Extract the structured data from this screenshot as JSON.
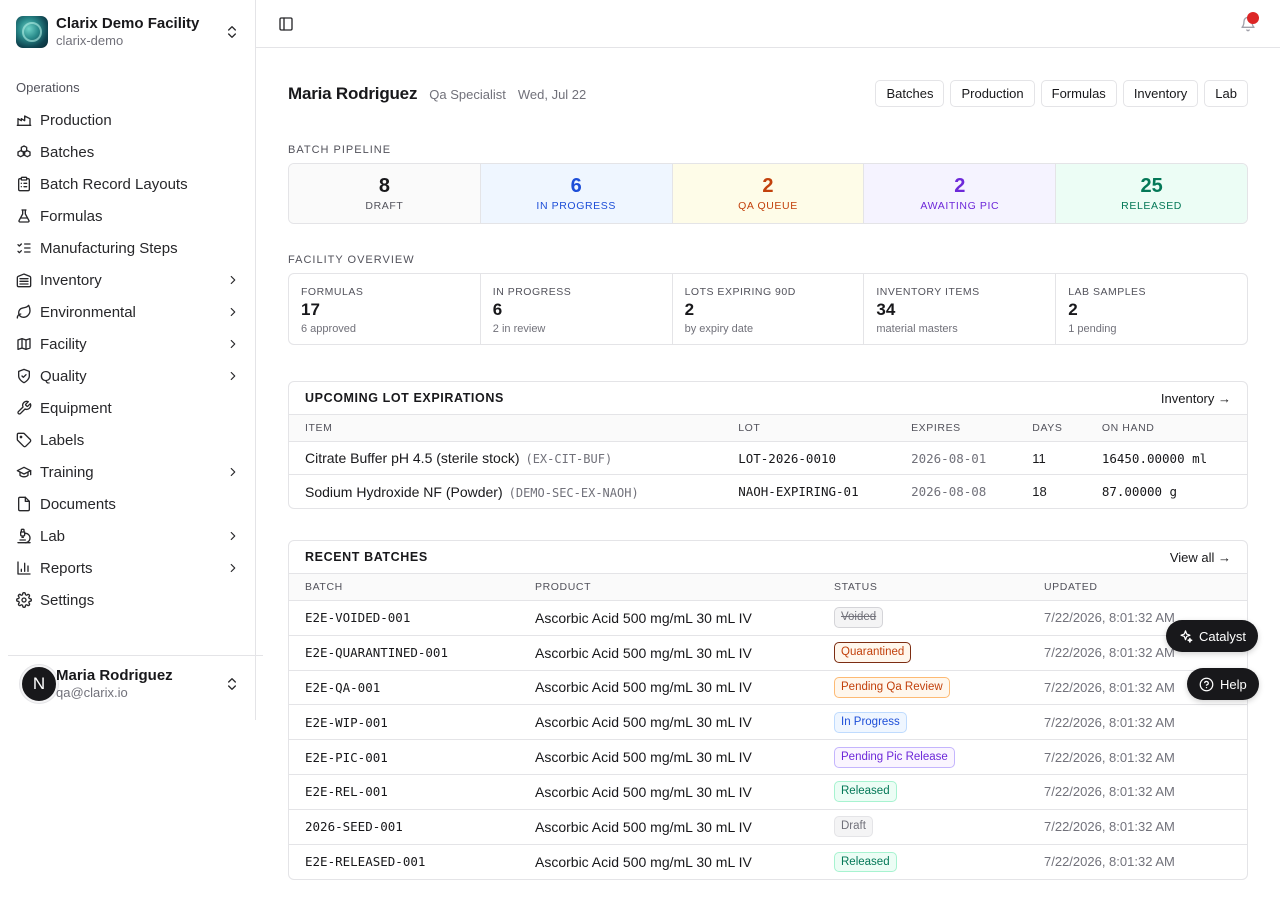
{
  "org": {
    "name": "Clarix Demo Facility",
    "slug": "clarix-demo"
  },
  "sidebar": {
    "section_label": "Operations",
    "items": [
      {
        "label": "Production",
        "icon": "factory-icon",
        "has_submenu": false
      },
      {
        "label": "Batches",
        "icon": "boxes-icon",
        "has_submenu": false
      },
      {
        "label": "Batch Record Layouts",
        "icon": "clipboard-list-icon",
        "has_submenu": false
      },
      {
        "label": "Formulas",
        "icon": "flask-icon",
        "has_submenu": false
      },
      {
        "label": "Manufacturing Steps",
        "icon": "list-checks-icon",
        "has_submenu": false
      },
      {
        "label": "Inventory",
        "icon": "warehouse-icon",
        "has_submenu": true
      },
      {
        "label": "Environmental",
        "icon": "leaf-icon",
        "has_submenu": true
      },
      {
        "label": "Facility",
        "icon": "map-icon",
        "has_submenu": true
      },
      {
        "label": "Quality",
        "icon": "shield-check-icon",
        "has_submenu": true
      },
      {
        "label": "Equipment",
        "icon": "wrench-icon",
        "has_submenu": false
      },
      {
        "label": "Labels",
        "icon": "tag-icon",
        "has_submenu": false
      },
      {
        "label": "Training",
        "icon": "graduation-cap-icon",
        "has_submenu": true
      },
      {
        "label": "Documents",
        "icon": "file-icon",
        "has_submenu": false
      },
      {
        "label": "Lab",
        "icon": "microscope-icon",
        "has_submenu": true
      },
      {
        "label": "Reports",
        "icon": "bar-chart-icon",
        "has_submenu": true
      },
      {
        "label": "Settings",
        "icon": "gear-icon",
        "has_submenu": false
      }
    ]
  },
  "user": {
    "initial": "N",
    "name": "Maria Rodriguez",
    "email": "qa@clarix.io"
  },
  "greeting": {
    "name": "Maria Rodriguez",
    "role": "Qa Specialist",
    "date": "Wed, Jul 22"
  },
  "quick_links": [
    "Batches",
    "Production",
    "Formulas",
    "Inventory",
    "Lab"
  ],
  "pipeline": {
    "caption": "BATCH PIPELINE",
    "stages": [
      {
        "count": "8",
        "label": "DRAFT",
        "color": "#18181b",
        "bg": "#fafafa"
      },
      {
        "count": "6",
        "label": "IN PROGRESS",
        "color": "#1d4ed8",
        "bg": "#eff6ff"
      },
      {
        "count": "2",
        "label": "QA QUEUE",
        "color": "#c2410c",
        "bg": "#fefce8"
      },
      {
        "count": "2",
        "label": "AWAITING PIC",
        "color": "#6d28d9",
        "bg": "#f5f3ff"
      },
      {
        "count": "25",
        "label": "RELEASED",
        "color": "#047857",
        "bg": "#ecfdf5"
      }
    ]
  },
  "overview": {
    "caption": "FACILITY OVERVIEW",
    "tiles": [
      {
        "label": "FORMULAS",
        "value": "17",
        "sub": "6 approved"
      },
      {
        "label": "IN PROGRESS",
        "value": "6",
        "sub": "2 in review"
      },
      {
        "label": "LOTS EXPIRING 90D",
        "value": "2",
        "sub": "by expiry date"
      },
      {
        "label": "INVENTORY ITEMS",
        "value": "34",
        "sub": "material masters"
      },
      {
        "label": "LAB SAMPLES",
        "value": "2",
        "sub": "1 pending"
      }
    ]
  },
  "expirations": {
    "title": "UPCOMING LOT EXPIRATIONS",
    "link": "Inventory →",
    "columns": [
      "ITEM",
      "LOT",
      "EXPIRES",
      "DAYS",
      "ON HAND"
    ],
    "rows": [
      {
        "item": "Citrate Buffer pH 4.5 (sterile stock)",
        "code": "(EX-CIT-BUF)",
        "lot": "LOT-2026-0010",
        "expires": "2026-08-01",
        "days": "11",
        "on_hand": "16450.00000 ml"
      },
      {
        "item": "Sodium Hydroxide NF (Powder)",
        "code": "(DEMO-SEC-EX-NAOH)",
        "lot": "NAOH-EXPIRING-01",
        "expires": "2026-08-08",
        "days": "18",
        "on_hand": "87.00000 g"
      }
    ]
  },
  "batches": {
    "title": "RECENT BATCHES",
    "link": "View all →",
    "columns": [
      "BATCH",
      "PRODUCT",
      "STATUS",
      "UPDATED"
    ],
    "rows": [
      {
        "batch": "E2E-VOIDED-001",
        "product": "Ascorbic Acid 500 mg/mL 30 mL IV",
        "status": "Voided",
        "updated": "7/22/2026, 8:01:32 AM",
        "badge": {
          "fg": "#71717a",
          "bg": "#f4f4f5",
          "border": "#d4d4d8",
          "strike": true
        }
      },
      {
        "batch": "E2E-QUARANTINED-001",
        "product": "Ascorbic Acid 500 mg/mL 30 mL IV",
        "status": "Quarantined",
        "updated": "7/22/2026, 8:01:32 AM",
        "badge": {
          "fg": "#c2410c",
          "bg": "#fff7ed",
          "border": "#7c2d12",
          "strike": false
        }
      },
      {
        "batch": "E2E-QA-001",
        "product": "Ascorbic Acid 500 mg/mL 30 mL IV",
        "status": "Pending Qa Review",
        "updated": "7/22/2026, 8:01:32 AM",
        "badge": {
          "fg": "#c2410c",
          "bg": "#fff7ed",
          "border": "#fdba74",
          "strike": false
        }
      },
      {
        "batch": "E2E-WIP-001",
        "product": "Ascorbic Acid 500 mg/mL 30 mL IV",
        "status": "In Progress",
        "updated": "7/22/2026, 8:01:32 AM",
        "badge": {
          "fg": "#1d4ed8",
          "bg": "#eff6ff",
          "border": "#bfdbfe",
          "strike": false
        }
      },
      {
        "batch": "E2E-PIC-001",
        "product": "Ascorbic Acid 500 mg/mL 30 mL IV",
        "status": "Pending Pic Release",
        "updated": "7/22/2026, 8:01:32 AM",
        "badge": {
          "fg": "#6d28d9",
          "bg": "#faf5ff",
          "border": "#c4b5fd",
          "strike": false
        }
      },
      {
        "batch": "E2E-REL-001",
        "product": "Ascorbic Acid 500 mg/mL 30 mL IV",
        "status": "Released",
        "updated": "7/22/2026, 8:01:32 AM",
        "badge": {
          "fg": "#047857",
          "bg": "#ecfdf5",
          "border": "#a7f3d0",
          "strike": false
        }
      },
      {
        "batch": "2026-SEED-001",
        "product": "Ascorbic Acid 500 mg/mL 30 mL IV",
        "status": "Draft",
        "updated": "7/22/2026, 8:01:32 AM",
        "badge": {
          "fg": "#71717a",
          "bg": "#f4f4f5",
          "border": "#e4e4e7",
          "strike": false
        }
      },
      {
        "batch": "E2E-RELEASED-001",
        "product": "Ascorbic Acid 500 mg/mL 30 mL IV",
        "status": "Released",
        "updated": "7/22/2026, 8:01:32 AM",
        "badge": {
          "fg": "#047857",
          "bg": "#ecfdf5",
          "border": "#a7f3d0",
          "strike": false
        }
      }
    ]
  },
  "fabs": {
    "catalyst": "Catalyst",
    "help": "Help"
  }
}
